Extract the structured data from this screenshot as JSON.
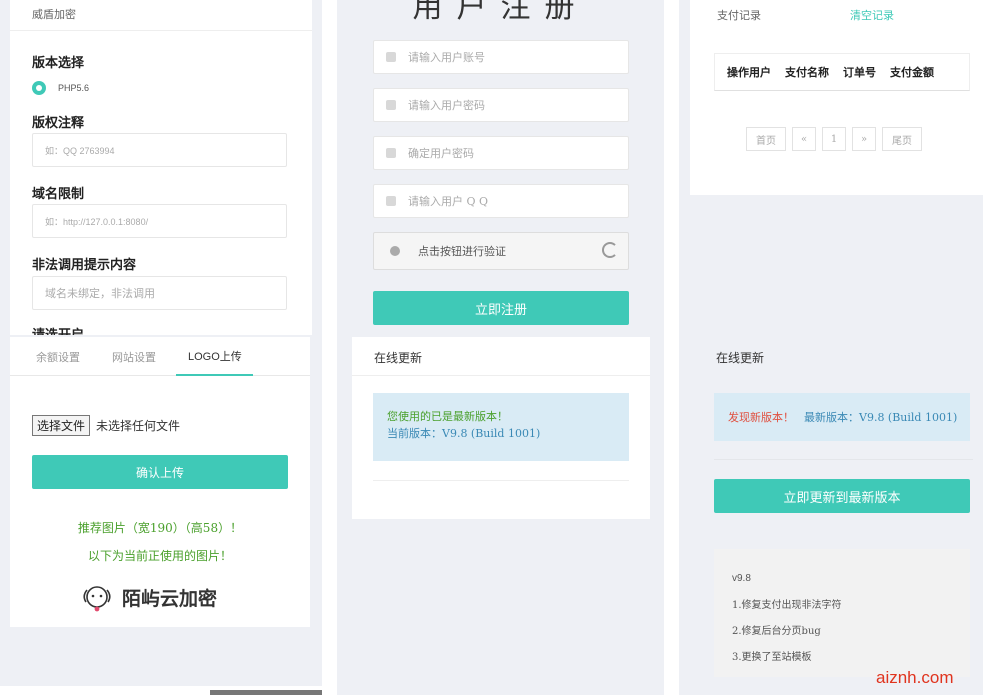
{
  "left_panel": {
    "title": "威盾加密",
    "version_label": "版本选择",
    "version_option": "PHP5.6",
    "author_label": "版权注释",
    "author_placeholder": "如：QQ 2763994",
    "domain_label": "域名限制",
    "domain_placeholder": "如：http://127.0.0.1:8080/",
    "illegal_label": "非法调用提示内容",
    "illegal_placeholder": "域名未绑定，非法调用",
    "cut_label": "请选开启"
  },
  "register": {
    "title": "用户注册",
    "username_placeholder": "请输入用户账号",
    "password_placeholder": "请输入用户密码",
    "confirm_placeholder": "确定用户密码",
    "qq_placeholder": "请输入用户 Q Q",
    "captcha_label": "点击按钮进行验证",
    "submit_label": "立即注册"
  },
  "payments": {
    "title": "支付记录",
    "clear_link": "清空记录",
    "columns": [
      "操作用户",
      "支付名称",
      "订单号",
      "支付金额"
    ],
    "pager": [
      "首页",
      "«",
      "1",
      "»",
      "尾页"
    ]
  },
  "logo_panel": {
    "tabs": [
      "余额设置",
      "网站设置",
      "LOGO上传"
    ],
    "file_button": "选择文件",
    "file_status": "未选择任何文件",
    "upload_button": "确认上传",
    "tip_line1": "推荐图片（宽190）（高58）！",
    "tip_line2": "以下为当前正使用的图片！",
    "logo_text": "陌屿云加密"
  },
  "update_mid": {
    "title": "在线更新",
    "msg_line1": "您使用的已是最新版本！",
    "msg_line2": "当前版本：V9.8 (Build 1001)"
  },
  "update_right": {
    "title": "在线更新",
    "new_label": "发现新版本！",
    "latest_label": "最新版本：V9.8 (Build 1001)",
    "update_button": "立即更新到最新版本",
    "log_version": "v9.8",
    "log_items": [
      "1.修复支付出现非法字符",
      "2.修复后台分页bug",
      "3.更换了至站模板"
    ]
  },
  "watermark": "aiznh.com",
  "colors": {
    "teal": "#3fc9b7",
    "info_bg": "#d9ebf5",
    "green_text": "#4aa02c",
    "red_text": "#e04f3f"
  }
}
